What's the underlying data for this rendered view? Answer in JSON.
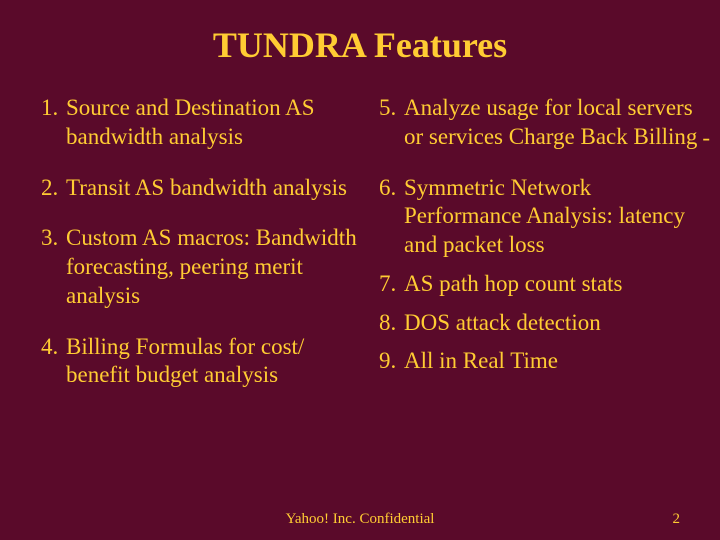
{
  "title": "TUNDRA Features",
  "left_start": 1,
  "right_start": 5,
  "left_items": [
    "Source and Destination AS bandwidth analysis",
    "Transit AS bandwidth analysis",
    "Custom AS macros: Bandwidth forecasting, peering merit analysis",
    "Billing Formulas for cost/ benefit budget analysis"
  ],
  "right_items": [
    "Analyze usage for local servers or services Charge Back Billing",
    "Symmetric Network Performance Analysis: latency and packet loss",
    "AS path hop count stats",
    "DOS attack detection",
    "All in Real Time"
  ],
  "dash": "-",
  "footer": "Yahoo! Inc. Confidential",
  "page_number": "2"
}
